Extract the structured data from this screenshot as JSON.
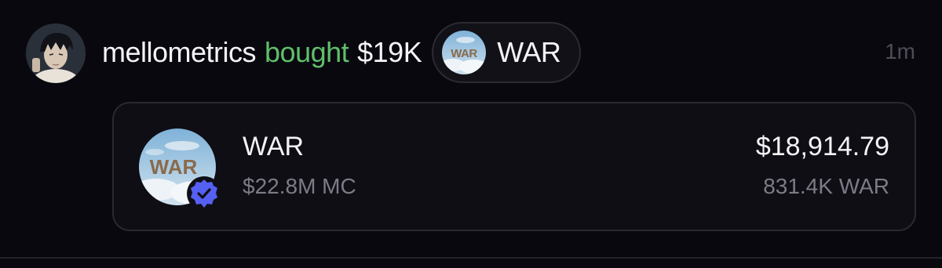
{
  "activity": {
    "username": "mellometrics",
    "action": "bought",
    "amount": "$19K",
    "token_symbol": "WAR",
    "timestamp": "1m"
  },
  "trade_card": {
    "token_name": "WAR",
    "market_cap": "$22.8M MC",
    "usd_value": "$18,914.79",
    "token_quantity": "831.4K WAR"
  },
  "token_logo_text": "WAR",
  "colors": {
    "background": "#09080f",
    "action_green": "#5fbf6a",
    "verified_blue": "#5560f2",
    "muted_text": "#7c7b86"
  },
  "icons": {
    "avatar": "user-avatar",
    "token_logo": "war-token-logo",
    "verified": "verified-check-icon"
  }
}
